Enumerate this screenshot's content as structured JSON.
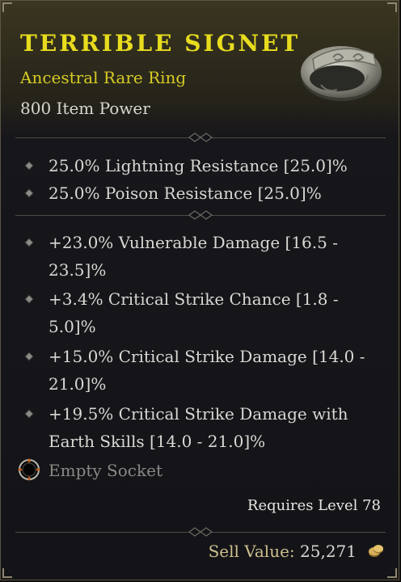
{
  "item": {
    "name": "TERRIBLE SIGNET",
    "type": "Ancestral Rare Ring",
    "power": "800 Item Power"
  },
  "colors": {
    "title": "#e8dc1e",
    "rare": "#d6cb24",
    "text": "#d9d8d4",
    "muted": "#8a8884"
  },
  "implicit_stats": [
    "25.0% Lightning Resistance [25.0]%",
    "25.0% Poison Resistance [25.0]%"
  ],
  "affixes": [
    {
      "line1": "+23.0% Vulnerable Damage [16.5 -",
      "line2": "23.5]%"
    },
    {
      "line1": "+3.4% Critical Strike Chance [1.8 -",
      "line2": "5.0]%"
    },
    {
      "line1": "+15.0% Critical Strike Damage [14.0 -",
      "line2": "21.0]%"
    },
    {
      "line1": "+19.5% Critical Strike Damage with",
      "line2": "Earth Skills [14.0 - 21.0]%"
    }
  ],
  "socket": {
    "label": "Empty Socket",
    "icon": "socket-icon"
  },
  "requirement": "Requires Level 78",
  "sell": {
    "label": "Sell Value:",
    "value": "25,271",
    "icon": "gold-coin-icon"
  }
}
